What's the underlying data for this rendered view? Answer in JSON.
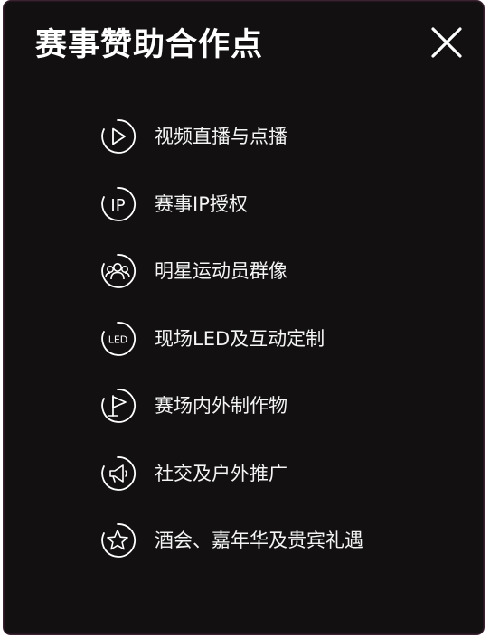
{
  "panel": {
    "title": "赛事赞助合作点",
    "close_glyph": "×"
  },
  "items": [
    {
      "label": "视频直播与点播",
      "icon": "play-circle-icon"
    },
    {
      "label": "赛事IP授权",
      "icon": "ip-badge-icon",
      "icon_text": "IP"
    },
    {
      "label": "明星运动员群像",
      "icon": "group-people-icon"
    },
    {
      "label": "现场LED及互动定制",
      "icon": "led-badge-icon",
      "icon_text": "LED"
    },
    {
      "label": "赛场内外制作物",
      "icon": "flag-icon"
    },
    {
      "label": "社交及户外推广",
      "icon": "megaphone-icon"
    },
    {
      "label": "酒会、嘉年华及贵宾礼遇",
      "icon": "star-icon"
    }
  ],
  "colors": {
    "background": "#121010",
    "text": "#ffffff",
    "divider": "#e8e8e8"
  }
}
